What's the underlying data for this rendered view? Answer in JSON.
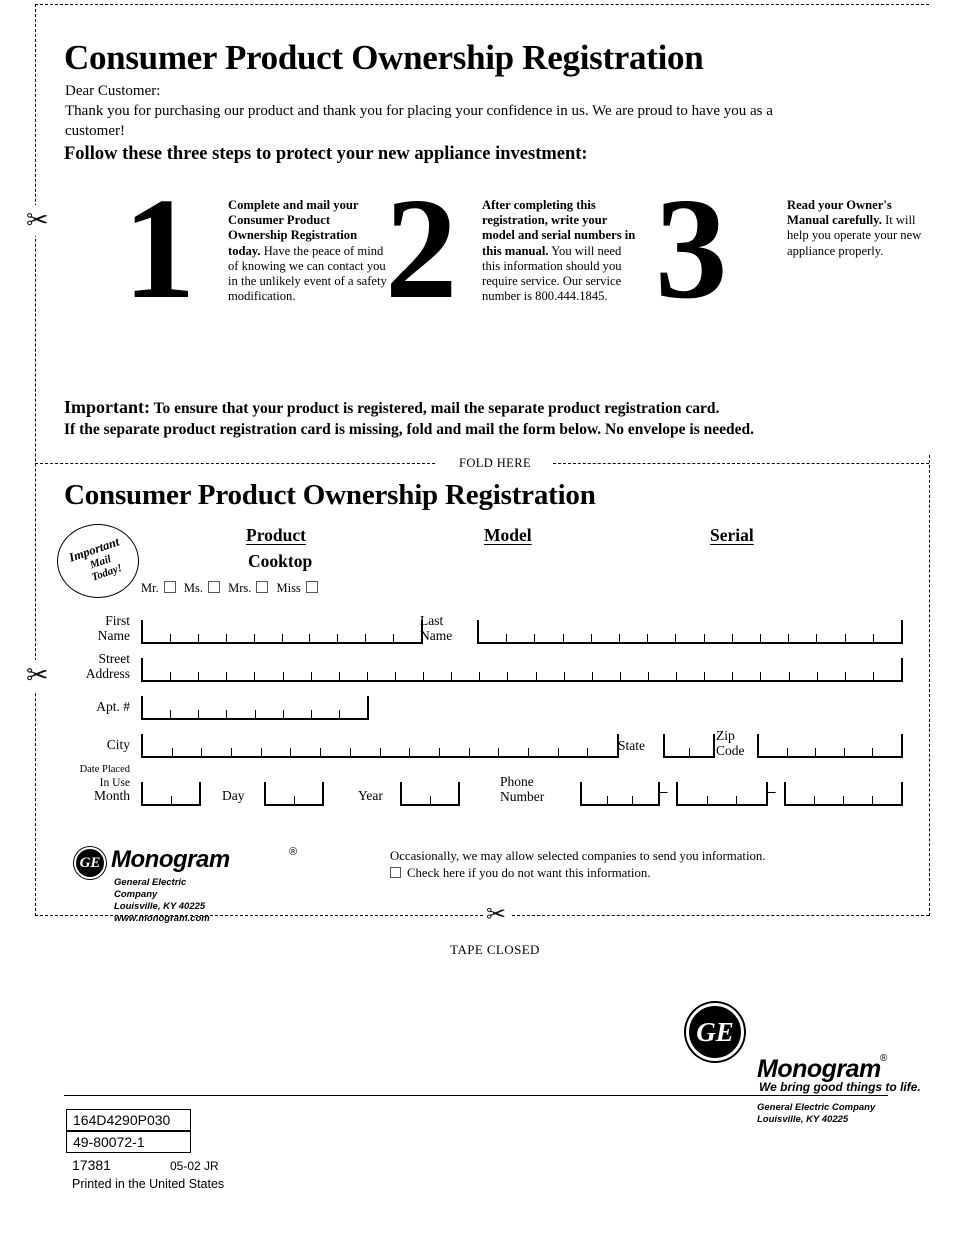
{
  "header": {
    "title": "Consumer Product Ownership Registration",
    "salutation": "Dear Customer:",
    "thanks": "Thank you for purchasing our product and thank you for placing your confidence in us. We are proud to have you as a customer!",
    "follow_steps": "Follow these three steps to protect your new appliance investment:"
  },
  "steps": [
    {
      "number": "1",
      "bold": "Complete and mail your Consumer Product Ownership Registration today.",
      "rest": "Have the peace of mind of knowing we can contact you in the unlikely event of a safety modification."
    },
    {
      "number": "2",
      "bold": "After completing this registration, write your model and serial numbers in this manual.",
      "rest": "You will need this information should you require service. Our service number is 800.444.1845."
    },
    {
      "number": "3",
      "bold": "Read your Owner's Manual carefully.",
      "rest": "It will help you operate your new appliance properly."
    }
  ],
  "important": {
    "label": "Important:",
    "line1": "To ensure that your product is registered, mail the separate product registration card.",
    "line2": "If the separate product registration card is missing, fold and mail the form below. No envelope is needed."
  },
  "fold_here": "FOLD HERE",
  "card": {
    "title": "Consumer Product Ownership Registration",
    "stamp": {
      "line1": "Important",
      "line2": "Mail",
      "line3": "Today!"
    },
    "columns": {
      "product": "Product",
      "model": "Model",
      "serial": "Serial"
    },
    "product_value": "Cooktop",
    "model_value": "",
    "serial_value": "",
    "titles": [
      "Mr.",
      "Ms.",
      "Mrs.",
      "Miss"
    ],
    "fields": {
      "first_name": "First\nName",
      "last_name": "Last\nName",
      "street_address": "Street\nAddress",
      "apt": "Apt. #",
      "city": "City",
      "state": "State",
      "zip": "Zip\nCode",
      "date_placed": "Date Placed",
      "in_use": "In Use",
      "month": "Month",
      "day": "Day",
      "year": "Year",
      "phone": "Phone\nNumber",
      "phone_separator": "–"
    },
    "logo": {
      "ge": "GE",
      "brand": "Monogram",
      "registered": "®",
      "company": "General Electric Company",
      "city_state": "Louisville, KY 40225",
      "website": "www.monogram.com"
    },
    "optout": {
      "line1": "Occasionally, we may allow selected companies to send you information.",
      "line2": "Check here if you do not want this information."
    }
  },
  "tape_closed": "TAPE CLOSED",
  "footer": {
    "ge": "GE",
    "brand": "Monogram",
    "registered": "®",
    "tagline": "We bring good things to life.",
    "company": "General Electric Company",
    "city_state": "Louisville, KY 40225",
    "part_number_1": "164D4290P030",
    "part_number_2": "49-80072-1",
    "part_number_3": "17381",
    "date_code": "05-02 JR",
    "printed": "Printed in the United States"
  },
  "icons": {
    "scissors": "✂"
  }
}
